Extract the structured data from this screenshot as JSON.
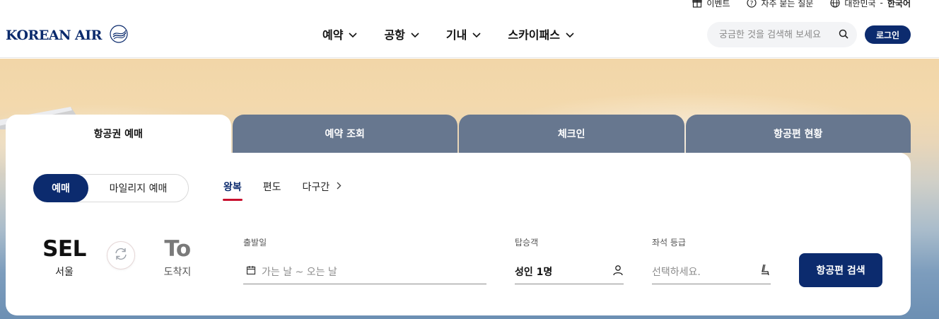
{
  "utility_bar": {
    "event": "이벤트",
    "faq": "자주 묻는 질문",
    "region": "대한민국",
    "separator": "-",
    "language": "한국어"
  },
  "header": {
    "logo_text": "KOREAN AIR",
    "nav": [
      {
        "label": "예약"
      },
      {
        "label": "공항"
      },
      {
        "label": "기내"
      },
      {
        "label": "스카이패스"
      }
    ],
    "search_placeholder": "궁금한 것을 검색해 보세요",
    "login_label": "로그인"
  },
  "booking": {
    "tabs": [
      {
        "label": "항공권 예매",
        "active": true
      },
      {
        "label": "예약 조회",
        "active": false
      },
      {
        "label": "체크인",
        "active": false
      },
      {
        "label": "항공편 현황",
        "active": false
      }
    ],
    "toggle": {
      "on": "예매",
      "off": "마일리지 예매"
    },
    "trip_types": [
      {
        "label": "왕복",
        "active": true
      },
      {
        "label": "편도",
        "active": false
      },
      {
        "label": "다구간",
        "active": false
      }
    ],
    "departure": {
      "code": "SEL",
      "city": "서울"
    },
    "arrival": {
      "code": "To",
      "city": "도착지"
    },
    "date": {
      "label": "출발일",
      "placeholder": "가는 날 ~ 오는 날"
    },
    "passengers": {
      "label": "탑승객",
      "value": "성인 1명"
    },
    "seat_class": {
      "label": "좌석 등급",
      "placeholder": "선택하세요."
    },
    "search_button": "항공편 검색"
  },
  "colors": {
    "brand_navy": "#0c2b6e",
    "inactive_tab": "#67778f",
    "accent_red": "#c8102e"
  }
}
